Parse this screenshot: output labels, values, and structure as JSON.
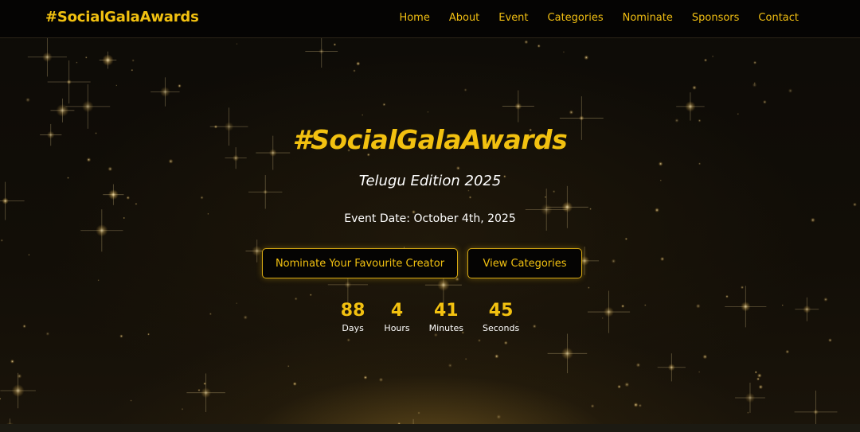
{
  "nav": {
    "brand": "#SocialGalaAwards",
    "links": [
      "Home",
      "About",
      "Event",
      "Categories",
      "Nominate",
      "Sponsors",
      "Contact"
    ]
  },
  "hero": {
    "title": "#SocialGalaAwards",
    "subtitle": "Telugu Edition 2025",
    "event_date": "Event Date: October 4th, 2025",
    "primary_button": "Nominate Your Favourite Creator",
    "secondary_button": "View Categories"
  },
  "countdown": {
    "days": {
      "value": "88",
      "label": "Days"
    },
    "hours": {
      "value": "4",
      "label": "Hours"
    },
    "minutes": {
      "value": "41",
      "label": "Minutes"
    },
    "seconds": {
      "value": "45",
      "label": "Seconds"
    }
  },
  "colors": {
    "accent": "#f2c110",
    "background": "#0a0805",
    "navbar": "#050403",
    "text": "#ffffff"
  }
}
